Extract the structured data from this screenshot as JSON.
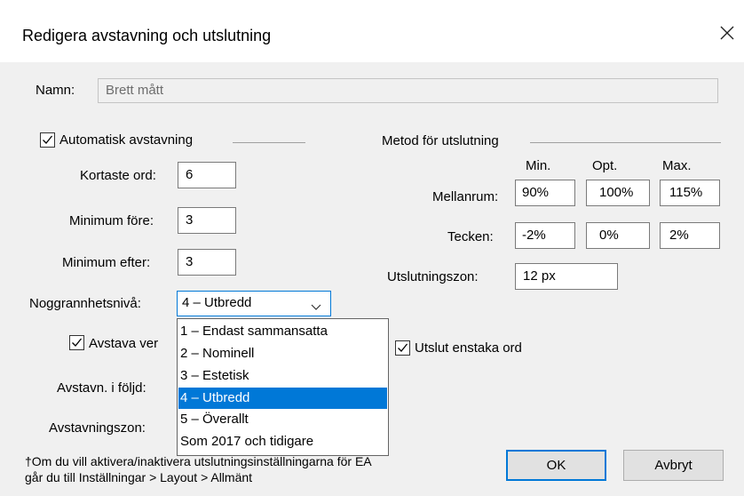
{
  "dialog": {
    "title": "Redigera avstavning och utslutning",
    "name_label": "Namn:",
    "name_value": "Brett mått"
  },
  "hyphenation": {
    "auto_label": "Automatisk avstavning",
    "auto_checked": true,
    "shortest_label": "Kortaste ord:",
    "shortest_value": "6",
    "min_before_label": "Minimum före:",
    "min_before_value": "3",
    "min_after_label": "Minimum efter:",
    "min_after_value": "3",
    "precision_label": "Noggrannhetsnivå:",
    "precision_value": "4 – Utbredd",
    "cap_words_label": "Avstava ver",
    "cap_words_checked": true,
    "in_row_label": "Avstavn. i följd:",
    "zone_label": "Avstavningszon:"
  },
  "dropdown": {
    "options": [
      "1 – Endast sammansatta",
      "2 – Nominell",
      "3 – Estetisk",
      "4 – Utbredd",
      "5 – Överallt",
      "Som 2017 och tidigare"
    ],
    "selected_index": 3
  },
  "justification": {
    "heading": "Metod för utslutning",
    "col_min": "Min.",
    "col_opt": "Opt.",
    "col_max": "Max.",
    "spacing_label": "Mellanrum:",
    "spacing_min": "90%",
    "spacing_opt": "100%",
    "spacing_max": "115%",
    "chars_label": "Tecken:",
    "chars_min": "-2%",
    "chars_opt": "0%",
    "chars_max": "2%",
    "zone_label": "Utslutningszon:",
    "zone_value": "12 px",
    "single_word_label": "Utslut enstaka ord",
    "single_word_checked": true
  },
  "footer": {
    "note_line1": "†Om du vill aktivera/inaktivera utslutningsinställningarna för EA",
    "note_line2": "går du till Inställningar > Layout > Allmänt",
    "ok_label": "OK",
    "cancel_label": "Avbryt"
  },
  "colors": {
    "accent": "#0078d7",
    "dialog_bg": "#f0f0f0"
  }
}
